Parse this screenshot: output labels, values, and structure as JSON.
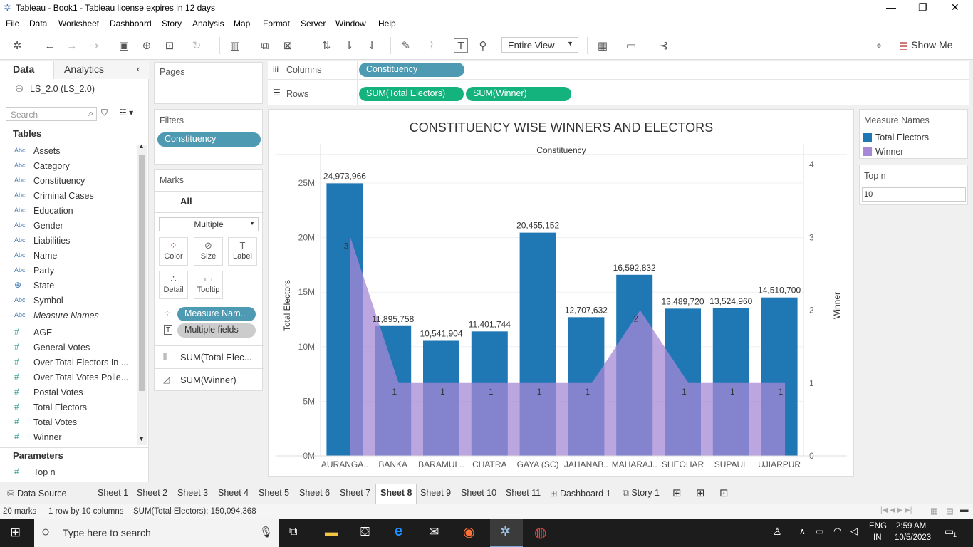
{
  "window": {
    "title": "Tableau - Book1 - Tableau license expires in 12 days"
  },
  "menu": [
    "File",
    "Data",
    "Worksheet",
    "Dashboard",
    "Story",
    "Analysis",
    "Map",
    "Format",
    "Server",
    "Window",
    "Help"
  ],
  "toolbar": {
    "view_select": "Entire View",
    "show_me": "Show Me"
  },
  "data_pane": {
    "tab_data": "Data",
    "tab_analytics": "Analytics",
    "datasource": "LS_2.0 (LS_2.0)",
    "search_placeholder": "Search",
    "tables_header": "Tables",
    "dimensions": [
      "Assets",
      "Category",
      "Constituency",
      "Criminal Cases",
      "Education",
      "Gender",
      "Liabilities",
      "Name",
      "Party",
      "State",
      "Symbol",
      "Measure Names"
    ],
    "dimension_type_label": "Abc",
    "measures": [
      "AGE",
      "General Votes",
      "Over Total Electors  In ...",
      "Over Total Votes Polle...",
      "Postal Votes",
      "Total Electors",
      "Total Votes",
      "Winner"
    ],
    "parameters_header": "Parameters",
    "parameters": [
      "Top n"
    ]
  },
  "shelves": {
    "pages_label": "Pages",
    "filters_label": "Filters",
    "filter_pill": "Constituency",
    "marks_label": "Marks",
    "marks_all": "All",
    "mark_type": "Multiple",
    "mark_buttons": [
      "Color",
      "Size",
      "Label",
      "Detail",
      "Tooltip"
    ],
    "mark_pills": [
      "Measure Nam..",
      "Multiple fields"
    ],
    "mark_cards": [
      "SUM(Total Elec...",
      "SUM(Winner)"
    ],
    "columns_label": "Columns",
    "columns_pill": "Constituency",
    "rows_label": "Rows",
    "rows_pills": [
      "SUM(Total Electors)",
      "SUM(Winner)"
    ]
  },
  "legend": {
    "title": "Measure Names",
    "items": [
      {
        "label": "Total Electors",
        "color": "#1f77b4"
      },
      {
        "label": "Winner",
        "color": "#a588d6"
      }
    ]
  },
  "topn": {
    "title": "Top n",
    "value": "10"
  },
  "chart_data": {
    "type": "bar",
    "title": "CONSTITUENCY WISE WINNERS AND ELECTORS",
    "xlabel": "Constituency",
    "ylabel": "Total Electors",
    "y2label": "Winner",
    "categories": [
      "AURANGA..",
      "BANKA",
      "BARAMUL..",
      "CHATRA",
      "GAYA (SC)",
      "JAHANAB..",
      "MAHARAJ..",
      "SHEOHAR",
      "SUPAUL",
      "UJIARPUR"
    ],
    "ylim": [
      0,
      25000000
    ],
    "y2lim": [
      0,
      4
    ],
    "y_ticks": [
      "0M",
      "5M",
      "10M",
      "15M",
      "20M",
      "25M"
    ],
    "y2_ticks": [
      "0",
      "1",
      "2",
      "3",
      "4"
    ],
    "series": [
      {
        "name": "Total Electors",
        "type": "bar",
        "color": "#1f77b4",
        "values": [
          24973966,
          11895758,
          10541904,
          11401744,
          20455152,
          12707632,
          16592832,
          13489720,
          13524960,
          14510700
        ],
        "labels": [
          "24,973,966",
          "11,895,758",
          "10,541,904",
          "11,401,744",
          "20,455,152",
          "12,707,632",
          "16,592,832",
          "13,489,720",
          "13,524,960",
          "14,510,700"
        ]
      },
      {
        "name": "Winner",
        "type": "area",
        "color": "#a588d6",
        "values": [
          3,
          1,
          1,
          1,
          1,
          1,
          2,
          1,
          1,
          1
        ],
        "labels": [
          "3",
          "1",
          "1",
          "1",
          "1",
          "1",
          "2",
          "1",
          "1",
          "1"
        ]
      }
    ]
  },
  "sheet_tabs": [
    "Data Source",
    "Sheet 1",
    "Sheet 2",
    "Sheet 3",
    "Sheet 4",
    "Sheet 5",
    "Sheet 6",
    "Sheet 7",
    "Sheet 8",
    "Sheet 9",
    "Sheet 10",
    "Sheet 11",
    "Dashboard 1",
    "Story 1"
  ],
  "status": {
    "marks": "20 marks",
    "rowscols": "1 row by 10 columns",
    "sum": "SUM(Total Electors): 150,094,368"
  },
  "taskbar": {
    "search_placeholder": "Type here to search",
    "lang1": "ENG",
    "lang2": "IN",
    "time": "2:59 AM",
    "date": "10/5/2023",
    "notif": "1"
  }
}
